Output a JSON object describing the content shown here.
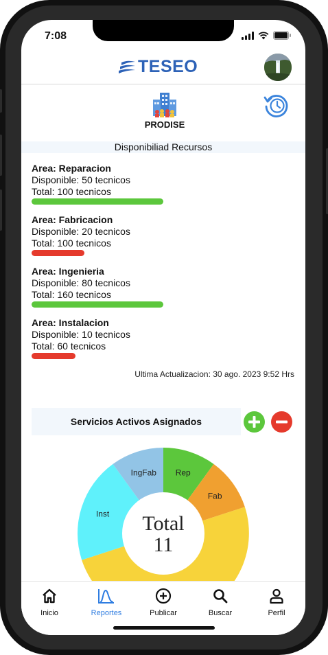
{
  "status": {
    "time": "7:08"
  },
  "header": {
    "logo_text": "TESEO"
  },
  "brand": {
    "name": "PRODISE"
  },
  "resources": {
    "title": "Disponibiliad Recursos",
    "areas": [
      {
        "title": "Area: Reparacion",
        "available": "Disponible: 50 tecnicos",
        "total": "Total: 100 tecnicos",
        "fraction": 0.5,
        "color": "#5cc73c"
      },
      {
        "title": "Area: Fabricacion",
        "available": "Disponible: 20 tecnicos",
        "total": "Total: 100 tecnicos",
        "fraction": 0.2,
        "color": "#e53a2c"
      },
      {
        "title": "Area: Ingenieria",
        "available": "Disponible: 80 tecnicos",
        "total": "Total: 160 tecnicos",
        "fraction": 0.5,
        "color": "#5cc73c"
      },
      {
        "title": "Area: Instalacion",
        "available": "Disponible: 10 tecnicos",
        "total": "Total: 60 tecnicos",
        "fraction": 0.167,
        "color": "#e53a2c"
      }
    ],
    "updated": "Ultima Actualizacion: 30 ago. 2023  9:52 Hrs"
  },
  "services": {
    "title": "Servicios Activos Asignados",
    "add_color": "#5cc73c",
    "remove_color": "#e53a2c"
  },
  "chart_data": {
    "type": "pie",
    "center_label": "Total",
    "center_value": "11",
    "slices": [
      {
        "label": "Rep",
        "value": 1,
        "color": "#5cc73c"
      },
      {
        "label": "Fab",
        "value": 1,
        "color": "#f0a030"
      },
      {
        "label": "",
        "value": 5,
        "color": "#f7d33a"
      },
      {
        "label": "Inst",
        "value": 2,
        "color": "#5ff1fb"
      },
      {
        "label": "IngFab",
        "value": 1,
        "color": "#92c4e6"
      }
    ]
  },
  "tabs": [
    {
      "label": "Inicio",
      "icon": "home-icon"
    },
    {
      "label": "Reportes",
      "icon": "chart-icon",
      "active": true
    },
    {
      "label": "Publicar",
      "icon": "plus-circle-icon"
    },
    {
      "label": "Buscar",
      "icon": "search-icon"
    },
    {
      "label": "Perfil",
      "icon": "person-icon"
    }
  ]
}
